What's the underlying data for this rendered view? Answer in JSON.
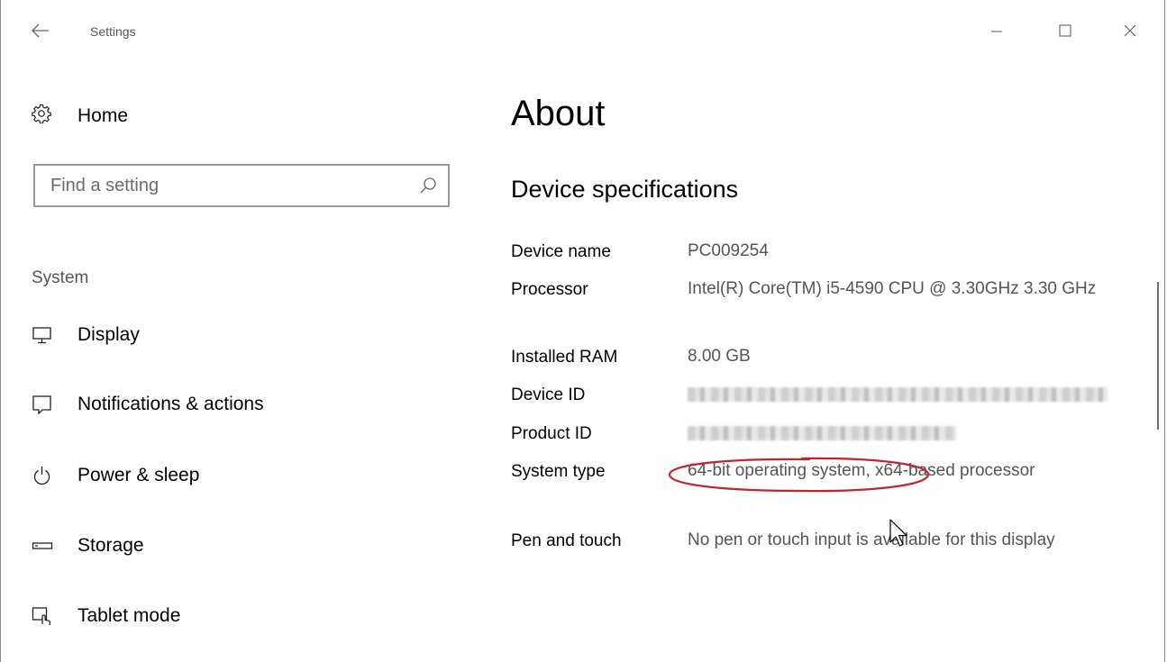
{
  "titlebar": {
    "title": "Settings",
    "back_icon": "back-arrow-icon",
    "controls": [
      "minimize-icon",
      "maximize-icon",
      "close-icon"
    ]
  },
  "sidebar": {
    "home": {
      "label": "Home",
      "icon": "gear-icon"
    },
    "search": {
      "placeholder": "Find a setting",
      "value": "",
      "icon": "search-icon"
    },
    "section_label": "System",
    "items": [
      {
        "label": "Display",
        "icon": "display-icon"
      },
      {
        "label": "Notifications & actions",
        "icon": "notification-icon"
      },
      {
        "label": "Power & sleep",
        "icon": "power-icon"
      },
      {
        "label": "Storage",
        "icon": "storage-icon"
      },
      {
        "label": "Tablet mode",
        "icon": "tablet-mode-icon"
      }
    ]
  },
  "main": {
    "page_title": "About",
    "section_title": "Device specifications",
    "specs": [
      {
        "label": "Device name",
        "value": "PC009254"
      },
      {
        "label": "Processor",
        "value": "Intel(R) Core(TM) i5-4590 CPU @ 3.30GHz 3.30 GHz"
      },
      {
        "label": "Installed RAM",
        "value": "8.00 GB"
      },
      {
        "label": "Device ID",
        "value": ""
      },
      {
        "label": "Product ID",
        "value": ""
      },
      {
        "label": "System type",
        "value": "64-bit operating system, x64-based processor"
      },
      {
        "label": "Pen and touch",
        "value": "No pen or touch input is available for this display"
      }
    ],
    "annotation_color": "#c0262c"
  },
  "colors": {
    "text_primary": "#000000",
    "text_secondary": "#555555",
    "search_border": "#999999"
  }
}
